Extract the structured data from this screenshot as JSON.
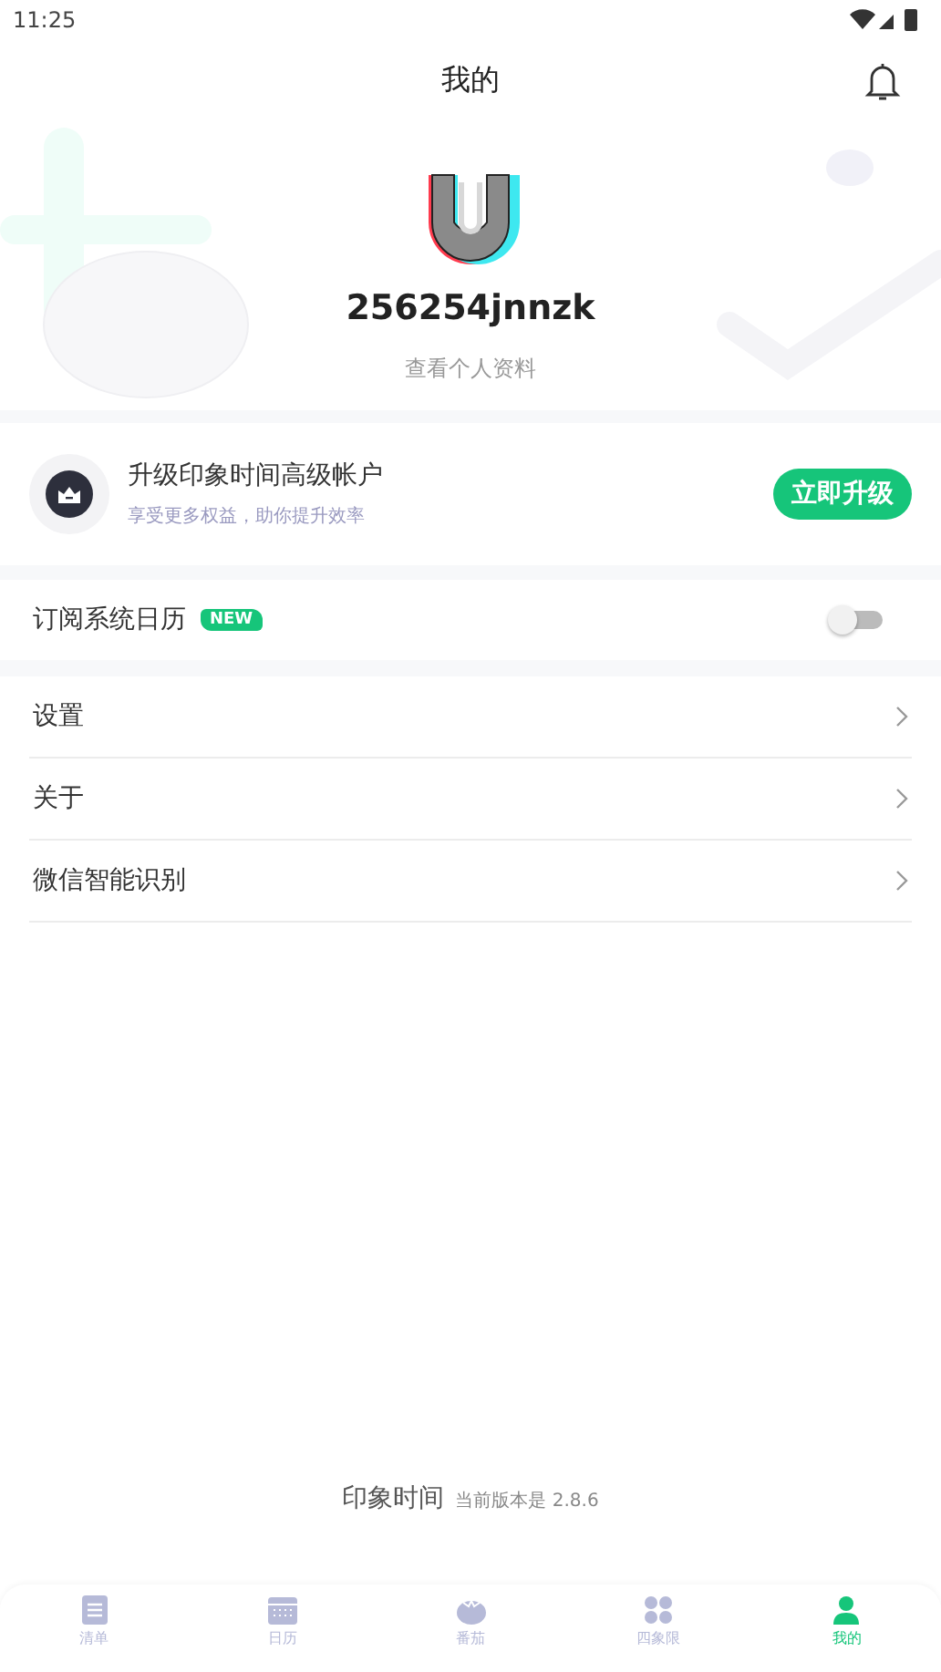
{
  "status_bar": {
    "time": "11:25"
  },
  "header": {
    "title": "我的"
  },
  "profile": {
    "username": "256254jnnzk",
    "link": "查看个人资料"
  },
  "upgrade": {
    "title": "升级印象时间高级帐户",
    "subtitle": "享受更多权益，助你提升效率",
    "button": "立即升级"
  },
  "subscribe": {
    "label": "订阅系统日历",
    "badge": "NEW",
    "on": false
  },
  "menu": [
    {
      "label": "设置"
    },
    {
      "label": "关于"
    },
    {
      "label": "微信智能识别"
    }
  ],
  "footer": {
    "app": "印象时间",
    "version": "当前版本是 2.8.6"
  },
  "tabs": [
    {
      "label": "清单",
      "kind": "list",
      "selected": false
    },
    {
      "label": "日历",
      "kind": "calendar",
      "selected": false
    },
    {
      "label": "番茄",
      "kind": "tomato",
      "selected": false
    },
    {
      "label": "四象限",
      "kind": "quadrant",
      "selected": false
    },
    {
      "label": "我的",
      "kind": "person",
      "selected": true
    }
  ]
}
